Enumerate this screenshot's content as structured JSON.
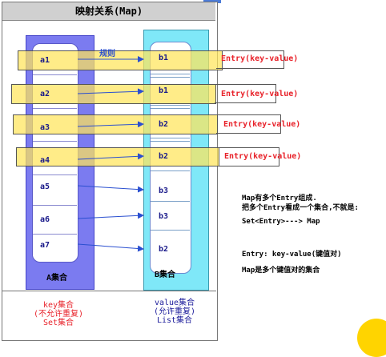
{
  "title": "映射关系(Map)",
  "rule_label": "规则",
  "set_a": {
    "label": "A集合",
    "items": [
      "a1",
      "a2",
      "a3",
      "a4",
      "a5",
      "a6",
      "a7"
    ],
    "caption": [
      "key集合",
      "(不允许重复)",
      "Set集合"
    ]
  },
  "set_b": {
    "label": "B集合",
    "items": [
      "b1",
      "b1",
      "b2",
      "b2",
      "b3",
      "b3",
      "b2"
    ],
    "caption": [
      "value集合",
      "(允许重复)",
      "List集合"
    ]
  },
  "entries": [
    "Entry(key-value)",
    "Entry(key-value)",
    "Entry(key-value)",
    "Entry(key-value)"
  ],
  "notes": {
    "line1": "Map有多个Entry组成.",
    "line2": "把多个Entry看成一个集合,不就是:",
    "line3": "Set<Entry>--->  Map",
    "line4": "Entry:  key-value(键值对)",
    "line5": "Map是多个键值对的集合"
  },
  "colors": {
    "set_a_fill": "#7b7bf0",
    "set_b_fill": "#7fe8f8",
    "band": "#ffe45a",
    "entry_text": "#e8222a",
    "arrow": "#2a4fd0",
    "caption_red": "#e8222a",
    "caption_blue": "#1a1a9a"
  }
}
